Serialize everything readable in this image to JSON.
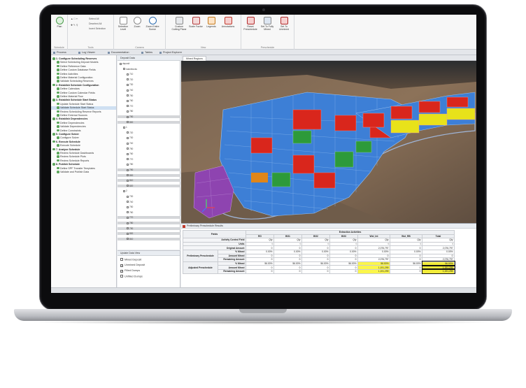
{
  "ribbon": {
    "groups": [
      {
        "label": "Schedule"
      },
      {
        "label": "Tools"
      },
      {
        "label": "Camera"
      },
      {
        "label": "View"
      },
      {
        "label": "Preschedule"
      }
    ],
    "buttons": [
      {
        "label": "Plan"
      },
      {
        "label": "Selection Level"
      },
      {
        "label": "Zoom"
      },
      {
        "label": "Zoom Entire Scene"
      },
      {
        "label": "Custom Cutting Plane"
      },
      {
        "label": "Scale Factor"
      },
      {
        "label": "Legends"
      },
      {
        "label": "Annotations"
      },
      {
        "label": "Reset Preschedule"
      },
      {
        "label": "Set To Fully Mined"
      },
      {
        "label": "Set To Unmined"
      }
    ],
    "select_all": "Select All",
    "deselect_all": "Deselect All",
    "invert_selection": "Invert Selection"
  },
  "tabs": [
    {
      "label": "Process"
    },
    {
      "label": "Log Viewer"
    },
    {
      "label": "Documentation"
    },
    {
      "label": "Tables"
    },
    {
      "label": "Project Explorer"
    }
  ],
  "process": {
    "items": [
      {
        "text": "1. Configure Scheduling Reserves",
        "head": true
      },
      {
        "text": "Select Scheduling Deposit Models"
      },
      {
        "text": "Define Reference Data"
      },
      {
        "text": "Define Custom Database Fields"
      },
      {
        "text": "Define Activities"
      },
      {
        "text": "Define Material Configuration"
      },
      {
        "text": "Validate Scheduling Reserves"
      },
      {
        "text": "2. Establish Schedule Configuration",
        "head": true
      },
      {
        "text": "Define Calendars"
      },
      {
        "text": "Define Custom Calendar Fields"
      },
      {
        "text": "Define Material Flow"
      },
      {
        "text": "3. Establish Schedule Start Status",
        "head": true
      },
      {
        "text": "Update Schedule Start Status"
      },
      {
        "text": "Validate Schedule Start Status",
        "sel": true
      },
      {
        "text": "Review Scheduling Reserve Reports"
      },
      {
        "text": "Define External Sources"
      },
      {
        "text": "4. Establish Dependencies",
        "head": true
      },
      {
        "text": "Define Dependencies"
      },
      {
        "text": "Validate Dependencies"
      },
      {
        "text": "Define Constraints"
      },
      {
        "text": "5. Configure Solver",
        "head": true
      },
      {
        "text": "Configure Solver"
      },
      {
        "text": "6. Execute Schedule",
        "head": true
      },
      {
        "text": "Execute Schedule"
      },
      {
        "text": "7. Analyze Schedule",
        "head": true
      },
      {
        "text": "Review Schedule Dashboards"
      },
      {
        "text": "Review Schedule Plots"
      },
      {
        "text": "Review Schedule Reports"
      },
      {
        "text": "8. Publish Schedule",
        "head": true
      },
      {
        "text": "Define SPF Transfer Templates"
      },
      {
        "text": "Validate and Publish Data"
      }
    ]
  },
  "tree": {
    "header": "Deposit Data",
    "items": [
      {
        "text": "deposit",
        "indent": 0
      },
      {
        "text": "mainblocks",
        "indent": 1
      },
      {
        "text": "710",
        "indent": 2
      },
      {
        "text": "720",
        "indent": 2
      },
      {
        "text": "730",
        "indent": 2
      },
      {
        "text": "740",
        "indent": 2
      },
      {
        "text": "750",
        "indent": 2
      },
      {
        "text": "760",
        "indent": 2
      },
      {
        "text": "770",
        "indent": 2
      },
      {
        "text": "780",
        "indent": 2
      },
      {
        "text": "790",
        "indent": 2,
        "shade": true
      },
      {
        "text": "800",
        "indent": 2,
        "shade": true
      },
      {
        "text": "1",
        "indent": 1
      },
      {
        "text": "720",
        "indent": 2
      },
      {
        "text": "730",
        "indent": 2
      },
      {
        "text": "740",
        "indent": 2
      },
      {
        "text": "750",
        "indent": 2
      },
      {
        "text": "760",
        "indent": 2
      },
      {
        "text": "770",
        "indent": 2
      },
      {
        "text": "780",
        "indent": 2
      },
      {
        "text": "790",
        "indent": 2,
        "shade": true
      },
      {
        "text": "800",
        "indent": 2,
        "shade": true
      },
      {
        "text": "810",
        "indent": 2,
        "shade": true
      },
      {
        "text": "820",
        "indent": 2,
        "shade": true
      },
      {
        "text": "2",
        "indent": 1
      },
      {
        "text": "730",
        "indent": 2
      },
      {
        "text": "740",
        "indent": 2
      },
      {
        "text": "750",
        "indent": 2
      },
      {
        "text": "760",
        "indent": 2
      },
      {
        "text": "770",
        "indent": 2,
        "shade": true
      },
      {
        "text": "780",
        "indent": 2,
        "shade": true
      },
      {
        "text": "790",
        "indent": 2,
        "shade": true
      },
      {
        "text": "800",
        "indent": 2,
        "shade": true
      },
      {
        "text": "810",
        "indent": 2,
        "shade": true
      }
    ]
  },
  "legend": {
    "header": "Update Data View",
    "items": [
      {
        "text": "Mined Deposit",
        "checked": false
      },
      {
        "text": "Unmined Deposit",
        "checked": true
      },
      {
        "text": "Filled Dumps",
        "checked": true
      },
      {
        "text": "Unfilled Dumps",
        "checked": false
      }
    ]
  },
  "viewport": {
    "tab": "Mined Regions"
  },
  "results": {
    "title": "Preliminary Preschedule Results",
    "fields_label": "Fields",
    "group_label": "Extraction Activities",
    "columns": [
      "RG",
      "BG1",
      "BG2",
      "BG3",
      "Wst_Int",
      "Wst_RB",
      "Total"
    ],
    "rows": [
      {
        "group": "",
        "label": "Activity Control Field",
        "values": [
          "Qty",
          "Qty",
          "Qty",
          "Qty",
          "Qty",
          "Qty",
          "Qty"
        ]
      },
      {
        "group": "",
        "label": "Units",
        "values": [
          "t",
          "t",
          "t",
          "t",
          "t",
          "t",
          "t"
        ]
      },
      {
        "group": "",
        "label": "Original Amount",
        "values": [
          "0",
          "0",
          "0",
          "0",
          "2,076,797",
          "0",
          "2,076,797"
        ]
      },
      {
        "group": "Preliminary Preschedule",
        "label": "% Mined",
        "values": [
          "0.00%",
          "0.00%",
          "0.00%",
          "0.00%",
          "0.00%",
          "0.00%",
          "0.00%"
        ]
      },
      {
        "group": "Preliminary Preschedule",
        "label": "Amount Mined",
        "values": [
          "0",
          "0",
          "0",
          "0",
          "0",
          "0",
          "0"
        ]
      },
      {
        "group": "Preliminary Preschedule",
        "label": "Remaining Amount",
        "values": [
          "0",
          "0",
          "0",
          "0",
          "2,076,797",
          "0",
          "2,076,797"
        ]
      },
      {
        "group": "Adjusted Preschedule",
        "label": "% Mined",
        "values": [
          "56.00%",
          "56.00%",
          "56.00%",
          "56.00%",
          "56.00%",
          "56.00%",
          "56.00%"
        ],
        "hl": [
          4,
          6
        ]
      },
      {
        "group": "Adjusted Preschedule",
        "label": "Amount Mined",
        "values": [
          "0",
          "0",
          "0",
          "0",
          "1,191,299",
          "0",
          "1,191,299"
        ],
        "hl": [
          4,
          6
        ]
      },
      {
        "group": "Adjusted Preschedule",
        "label": "Remaining Amount",
        "values": [
          "0",
          "0",
          "0",
          "0",
          "1,191,299",
          "0",
          "1,191,299"
        ],
        "hl": [
          4,
          6
        ]
      }
    ]
  },
  "colors": {
    "block_blue": "#3d7fd6",
    "block_red": "#d9261c",
    "block_green": "#2d9a3a",
    "block_yellow": "#e8e21a",
    "block_purple": "#8e44b0",
    "highlight": "#fbf64a"
  }
}
